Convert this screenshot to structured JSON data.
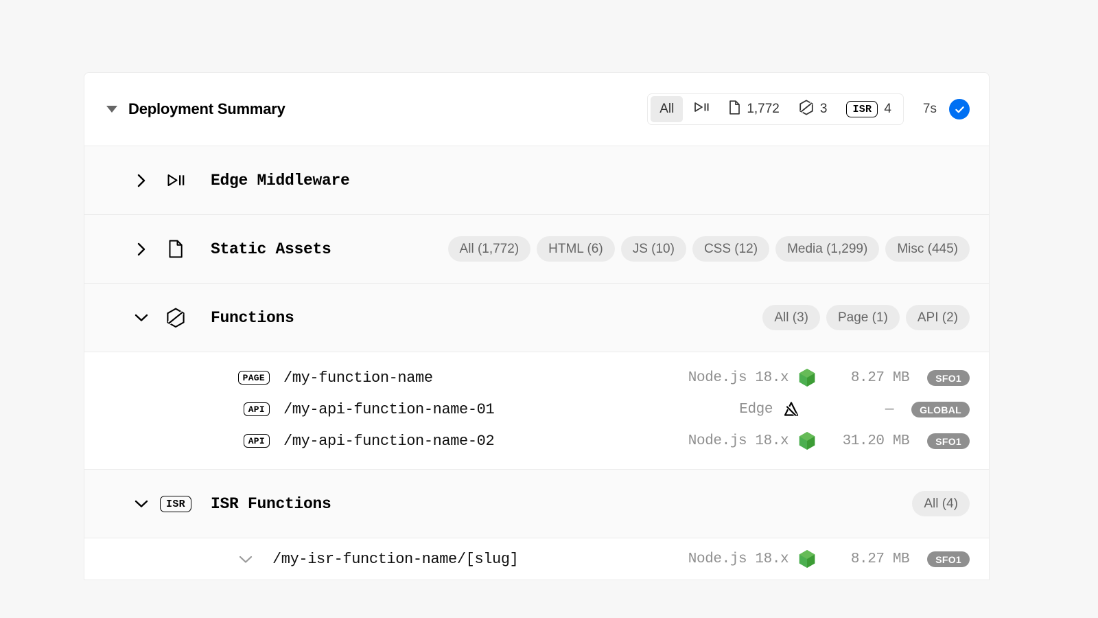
{
  "header": {
    "title": "Deployment Summary",
    "collapse_icon": "triangle-down-icon",
    "stats": [
      {
        "id": "all",
        "label": "All",
        "icon": null,
        "value": null,
        "active": true
      },
      {
        "id": "middleware",
        "label": null,
        "icon": "edge-middleware-icon",
        "value": null,
        "active": false
      },
      {
        "id": "static",
        "label": null,
        "icon": "file-icon",
        "value": "1,772",
        "active": false
      },
      {
        "id": "functions",
        "label": null,
        "icon": "functions-hex-icon",
        "value": "3",
        "active": false
      },
      {
        "id": "isr",
        "label": "ISR",
        "icon": "isr-badge",
        "value": "4",
        "active": false
      }
    ],
    "duration": "7s",
    "status_icon": "check-icon",
    "status_color": "#0070f3"
  },
  "sections": [
    {
      "id": "edge-middleware",
      "title": "Edge Middleware",
      "expanded": false,
      "chevron": "chevron-right-icon",
      "icon": "edge-middleware-icon",
      "pills": []
    },
    {
      "id": "static-assets",
      "title": "Static Assets",
      "expanded": false,
      "chevron": "chevron-right-icon",
      "icon": "file-icon",
      "pills": [
        "All (1,772)",
        "HTML (6)",
        "JS (10)",
        "CSS (12)",
        "Media (1,299)",
        "Misc (445)"
      ]
    },
    {
      "id": "functions",
      "title": "Functions",
      "expanded": true,
      "chevron": "chevron-down-icon",
      "icon": "functions-hex-icon",
      "pills": [
        "All (3)",
        "Page (1)",
        "API (2)"
      ]
    },
    {
      "id": "isr-functions",
      "title": "ISR Functions",
      "expanded": true,
      "chevron": "chevron-down-icon",
      "icon": "isr-badge",
      "icon_label": "ISR",
      "pills": [
        "All (4)"
      ]
    }
  ],
  "functions": [
    {
      "badge": "PAGE",
      "path": "/my-function-name",
      "runtime": "Node.js 18.x",
      "runtime_icon": "nodejs-hex-icon",
      "size": "8.27 MB",
      "region": "SFO1"
    },
    {
      "badge": "API",
      "path": "/my-api-function-name-01",
      "runtime": "Edge",
      "runtime_icon": "edge-triangle-icon",
      "size": "—",
      "region": "GLOBAL"
    },
    {
      "badge": "API",
      "path": "/my-api-function-name-02",
      "runtime": "Node.js 18.x",
      "runtime_icon": "nodejs-hex-icon",
      "size": "31.20 MB",
      "region": "SFO1"
    }
  ],
  "isr_functions": [
    {
      "chevron": "chevron-down-icon",
      "path": "/my-isr-function-name/[slug]",
      "runtime": "Node.js 18.x",
      "runtime_icon": "nodejs-hex-icon",
      "size": "8.27 MB",
      "region": "SFO1"
    }
  ],
  "colors": {
    "accent": "#0070f3",
    "node_green": "#3c9c35",
    "pill_bg": "#ebebeb",
    "region_bg": "#8f8f8f",
    "page_bg": "#f7f7f7",
    "section_bg": "#fafafa"
  }
}
